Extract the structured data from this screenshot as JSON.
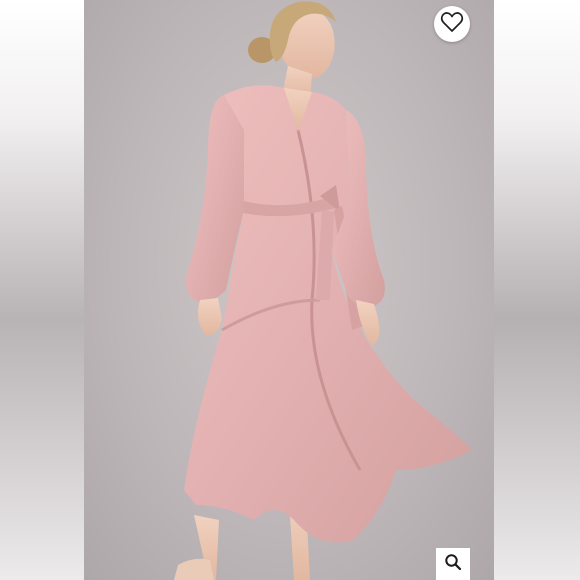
{
  "product_viewer": {
    "image": {
      "subject": "model-wearing-pink-satin-wrap-maxi-dress",
      "dress_color": "#e3b4b4",
      "background_color": "#c3bcbe"
    },
    "favorite_button": {
      "icon": "heart-outline-icon"
    },
    "zoom_button": {
      "icon": "magnifier-icon"
    }
  }
}
